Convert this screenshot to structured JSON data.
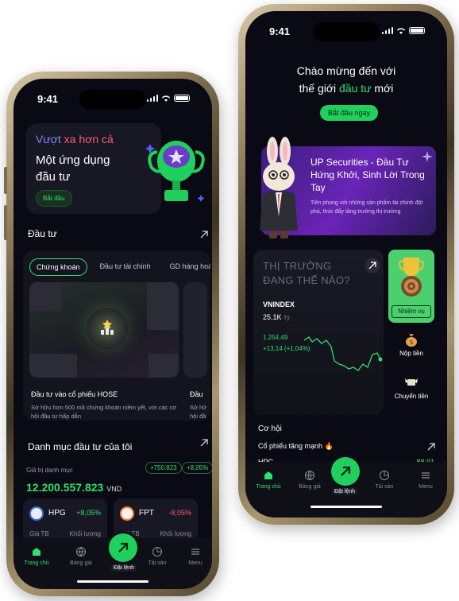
{
  "left_phone": {
    "status": {
      "time": "9:41"
    },
    "hero": {
      "title_part1": "Vượt ",
      "title_part2": "xa hơn cả",
      "subtitle_line1": "Một ứng dụng",
      "subtitle_line2": "đầu tư",
      "button": "Bắt đầu"
    },
    "invest": {
      "title": "Đầu tư",
      "tabs": [
        "Chứng khoán",
        "Đầu tư tài chính",
        "GD hàng hoá"
      ],
      "card_title": "Đầu tư vào cổ phiếu HOSE",
      "card_desc": "Sở hữu hơn 500 mã chứng khoán niêm yết, với các cơ hội đầu tư hấp dẫn",
      "card2_title": "Đầu",
      "card2_desc_1": "Sở hữ",
      "card2_desc_2": "hội đầ"
    },
    "portfolio": {
      "title": "Danh mục đầu tư của tôi",
      "label": "Giá trị danh mục",
      "value": "12.200.557.823",
      "currency": "VND",
      "change_abs": "+750.823",
      "change_pct": "+8,05%"
    },
    "stocks": [
      {
        "symbol": "HPG",
        "change": "+8,05%",
        "avg_label": "Giá TB",
        "vol_label": "Khối lượng"
      },
      {
        "symbol": "FPT",
        "change": "-8,05%",
        "avg_label": "Giá TB",
        "vol_label": "Khối lượng"
      }
    ],
    "tabbar": {
      "home": "Trang chủ",
      "price": "Bảng giá",
      "order": "Đặt lệnh",
      "assets": "Tài sản",
      "menu": "Menu"
    }
  },
  "right_phone": {
    "status": {
      "time": "9:41"
    },
    "welcome": {
      "line1": "Chào mừng đến với",
      "line2_a": "thế giới ",
      "line2_b": "đầu tư",
      "line2_c": " mới",
      "button": "Bắt đầu ngay"
    },
    "banner": {
      "title": "UP Securities - Đầu Tư Hứng Khởi, Sinh Lời Trong Tay",
      "desc": "Tiên phong với những sản phẩm tài chính đột phá, thúc đẩy tăng trưởng thị trường"
    },
    "market": {
      "title_line1": "THỊ TRƯỜNG",
      "title_line2": "ĐANG THẾ NÀO?",
      "index": "VNINDEX",
      "volume": "25.1K",
      "volume_unit": "Tỷ",
      "price": "1.254,49",
      "change": "+13,14 (+1,04%)"
    },
    "sidelinks": {
      "mission": "Nhiệm vụ",
      "deposit": "Nộp tiền",
      "transfer": "Chuyển tiền"
    },
    "opportunity": {
      "title": "Cơ hội",
      "hot": "Cổ phiếu tăng mạnh 🔥",
      "symbol": "HPG",
      "value": "88,91"
    },
    "tabbar": {
      "home": "Trang chủ",
      "price": "Bảng giá",
      "order": "Đặt lệnh",
      "assets": "Tài sản",
      "menu": "Menu"
    }
  },
  "colors": {
    "accent": "#1fd15c",
    "background": "#0a0a14",
    "negative": "#ff5a6a"
  }
}
